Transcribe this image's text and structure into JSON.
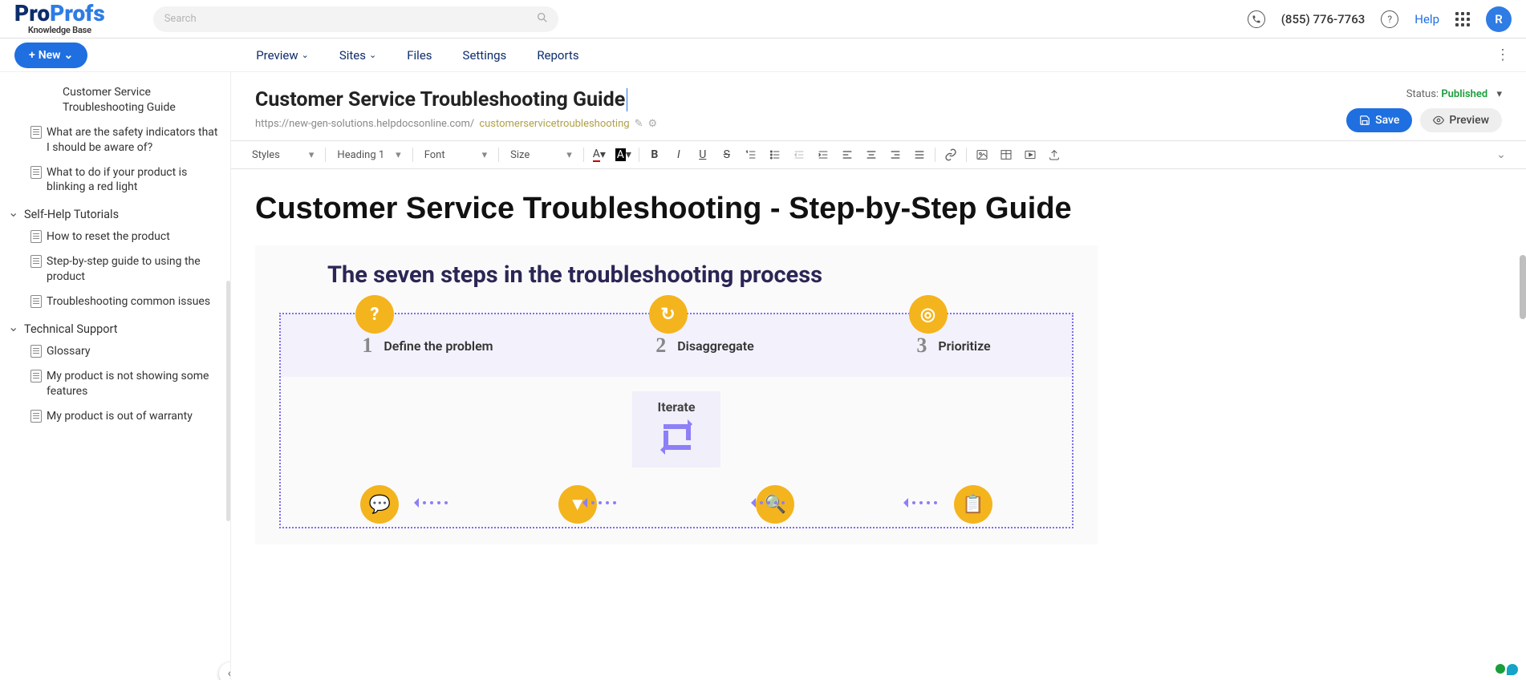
{
  "brand": {
    "part1": "Pro",
    "part2": "Profs",
    "sub": "Knowledge Base"
  },
  "search": {
    "placeholder": "Search"
  },
  "header": {
    "phone": "(855) 776-7763",
    "help": "Help",
    "avatar": "R"
  },
  "new_button": "New",
  "nav": {
    "preview": "Preview",
    "sites": "Sites",
    "files": "Files",
    "settings": "Settings",
    "reports": "Reports"
  },
  "sidebar": {
    "items_top": [
      "Customer Service Troubleshooting Guide",
      "What are the safety indicators that I should be aware of?",
      "What to do if your product is blinking a red light"
    ],
    "section_selfhelp": "Self-Help Tutorials",
    "items_selfhelp": [
      "How to reset the product",
      "Step-by-step guide to using the product",
      "Troubleshooting common issues"
    ],
    "section_tech": "Technical Support",
    "items_tech": [
      "Glossary",
      "My product is not showing some features",
      "My product is out of warranty"
    ]
  },
  "doc": {
    "title": "Customer Service Troubleshooting Guide",
    "url_base": "https://new-gen-solutions.helpdocsonline.com/",
    "url_slug": "customerservicetroubleshooting",
    "status_label": "Status:",
    "status_value": "Published",
    "save": "Save",
    "preview": "Preview"
  },
  "toolbar": {
    "styles": "Styles",
    "format": "Heading 1",
    "font": "Font",
    "size": "Size"
  },
  "editor": {
    "h1": "Customer Service Troubleshooting - Step-by-Step Guide",
    "figure_title": "The seven steps in the troubleshooting process",
    "steps": [
      {
        "num": "1",
        "label": "Define the problem",
        "icon": "?"
      },
      {
        "num": "2",
        "label": "Disaggregate",
        "icon": "↻"
      },
      {
        "num": "3",
        "label": "Prioritize",
        "icon": "◎"
      }
    ],
    "iterate": "Iterate"
  }
}
